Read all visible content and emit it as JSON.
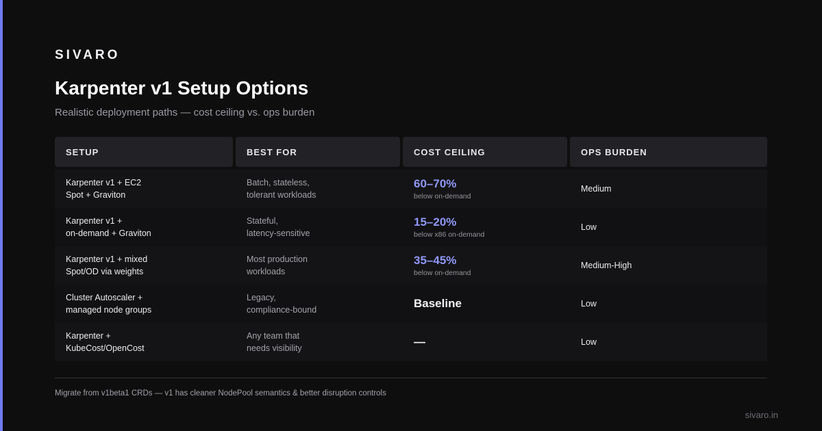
{
  "brand": "SIVARO",
  "title": "Karpenter v1 Setup Options",
  "subtitle": "Realistic deployment paths — cost ceiling vs. ops burden",
  "colors": {
    "accent": "#6f7cf0",
    "highlight": "#8f98f6",
    "background": "#0e0e0f"
  },
  "table": {
    "headers": {
      "setup": "SETUP",
      "best_for": "BEST FOR",
      "cost": "COST CEILING",
      "ops": "OPS BURDEN"
    },
    "rows": [
      {
        "setup": "Karpenter v1 + EC2\nSpot + Graviton",
        "best_for": "Batch, stateless,\ntolerant workloads",
        "cost": "60–70%",
        "cost_note": "below on-demand",
        "ops": "Medium"
      },
      {
        "setup": "Karpenter v1 +\non-demand + Graviton",
        "best_for": "Stateful,\nlatency-sensitive",
        "cost": "15–20%",
        "cost_note": "below x86 on-demand",
        "ops": "Low"
      },
      {
        "setup": "Karpenter v1 + mixed\nSpot/OD via weights",
        "best_for": "Most production\nworkloads",
        "cost": "35–45%",
        "cost_note": "below on-demand",
        "ops": "Medium-High"
      },
      {
        "setup": "Cluster Autoscaler +\nmanaged node groups",
        "best_for": "Legacy,\ncompliance-bound",
        "cost": "Baseline",
        "cost_note": "",
        "ops": "Low"
      },
      {
        "setup": "Karpenter +\nKubeCost/OpenCost",
        "best_for": "Any team that\nneeds visibility",
        "cost": "—",
        "cost_note": "",
        "ops": "Low"
      }
    ]
  },
  "footnote": "Migrate from v1beta1 CRDs — v1 has cleaner NodePool semantics & better disruption controls",
  "site": "sivaro.in"
}
